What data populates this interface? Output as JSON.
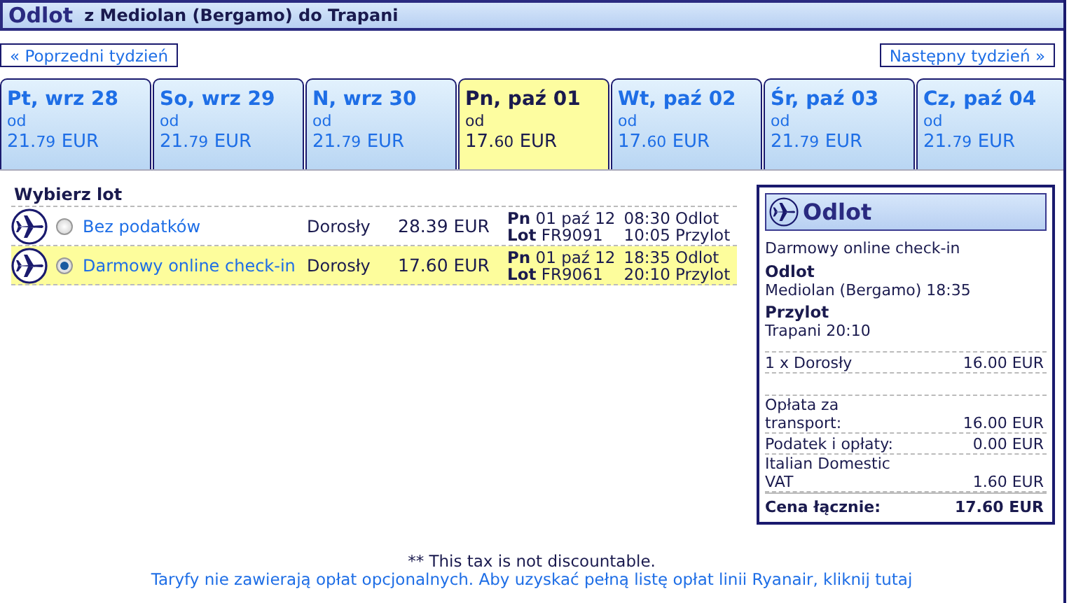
{
  "header": {
    "title": "Odlot",
    "route": "z Mediolan (Bergamo) do Trapani"
  },
  "nav": {
    "prev": "« Poprzedni tydzień",
    "next": "Następny tydzień »"
  },
  "days": [
    {
      "label": "Pt, wrz 28",
      "from": "od",
      "whole": "21.",
      "cents": "79",
      "currency": "EUR",
      "selected": false
    },
    {
      "label": "So, wrz 29",
      "from": "od",
      "whole": "21.",
      "cents": "79",
      "currency": "EUR",
      "selected": false
    },
    {
      "label": "N, wrz 30",
      "from": "od",
      "whole": "21.",
      "cents": "79",
      "currency": "EUR",
      "selected": false
    },
    {
      "label": "Pn, paź 01",
      "from": "od",
      "whole": "17.",
      "cents": "60",
      "currency": "EUR",
      "selected": true
    },
    {
      "label": "Wt, paź 02",
      "from": "od",
      "whole": "17.",
      "cents": "60",
      "currency": "EUR",
      "selected": false
    },
    {
      "label": "Śr, paź 03",
      "from": "od",
      "whole": "21.",
      "cents": "79",
      "currency": "EUR",
      "selected": false
    },
    {
      "label": "Cz, paź 04",
      "from": "od",
      "whole": "21.",
      "cents": "79",
      "currency": "EUR",
      "selected": false
    }
  ],
  "flights": {
    "heading": "Wybierz lot",
    "rows": [
      {
        "fare": "Bez podatków",
        "passenger": "Dorosły",
        "price": "28.39 EUR",
        "day": "Pn",
        "date": "01 paź 12",
        "flight_label": "Lot",
        "flight": "FR9091",
        "dep_time": "08:30",
        "dep_label": "Odlot",
        "arr_time": "10:05",
        "arr_label": "Przylot",
        "selected": false
      },
      {
        "fare": "Darmowy online check-in",
        "passenger": "Dorosły",
        "price": "17.60 EUR",
        "day": "Pn",
        "date": "01 paź 12",
        "flight_label": "Lot",
        "flight": "FR9061",
        "dep_time": "18:35",
        "dep_label": "Odlot",
        "arr_time": "20:10",
        "arr_label": "Przylot",
        "selected": true
      }
    ]
  },
  "summary": {
    "title": "Odlot",
    "fare": "Darmowy online check-in",
    "dep_heading": "Odlot",
    "dep": "Mediolan (Bergamo) 18:35",
    "arr_heading": "Przylot",
    "arr": "Trapani 20:10",
    "passengers": {
      "label": "1 x Dorosły",
      "amount": "16.00 EUR"
    },
    "lines": [
      {
        "label": "Opłata za transport:",
        "amount": "16.00 EUR"
      },
      {
        "label": "Podatek i opłaty:",
        "amount": "0.00 EUR"
      },
      {
        "label": "Italian Domestic VAT",
        "amount": "1.60 EUR"
      }
    ],
    "total": {
      "label": "Cena łącznie:",
      "amount": "17.60 EUR"
    }
  },
  "footer": {
    "note": "** This tax is not discountable.",
    "link": "Taryfy nie zawierają opłat opcjonalnych. Aby uzyskać pełną listę opłat linii Ryanair, kliknij tutaj"
  }
}
